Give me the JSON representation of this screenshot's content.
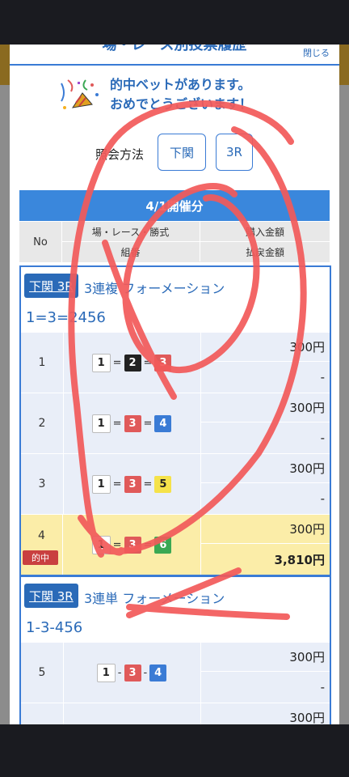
{
  "modal": {
    "title": "場・レース別投票履歴",
    "close_label": "閉じる",
    "hit_message_line1": "的中ベットがあります。",
    "hit_message_line2": "おめでとうございます！",
    "lookup_label": "照会方法",
    "lookup_buttons": [
      "下関",
      "3R"
    ]
  },
  "table": {
    "date_header": "4/1開催分",
    "col_no": "No",
    "col_race": "場・レース・勝式",
    "col_combo": "組番",
    "col_purchase": "購入金額",
    "col_payout": "払戻金額"
  },
  "blocks": [
    {
      "venue": "下関 3R",
      "bet_type": "3連複 フォーメーション",
      "combo": "1=3=2456",
      "rows": [
        {
          "no": "1",
          "boxes": [
            "1",
            "2",
            "3"
          ],
          "sep": "=",
          "purchase": "300円",
          "payout": "-"
        },
        {
          "no": "2",
          "boxes": [
            "1",
            "3",
            "4"
          ],
          "sep": "=",
          "purchase": "300円",
          "payout": "-"
        },
        {
          "no": "3",
          "boxes": [
            "1",
            "3",
            "5"
          ],
          "sep": "=",
          "purchase": "300円",
          "payout": "-"
        },
        {
          "no": "4",
          "boxes": [
            "1",
            "3",
            "6"
          ],
          "sep": "=",
          "purchase": "300円",
          "payout": "3,810円",
          "hit": true
        }
      ]
    },
    {
      "venue": "下関 3R",
      "bet_type": "3連単 フォーメーション",
      "combo": "1-3-456",
      "rows": [
        {
          "no": "5",
          "boxes": [
            "1",
            "3",
            "4"
          ],
          "sep": "-",
          "purchase": "300円",
          "payout": "-"
        },
        {
          "no": "",
          "boxes": [],
          "sep": "-",
          "purchase": "300円",
          "payout": ""
        }
      ]
    }
  ],
  "hit_badge_label": "的中",
  "colors": {
    "accent": "#3a7bd5",
    "header_blue": "#3a87dc",
    "hit_row": "#fbeda8",
    "scribble": "#f25a5a"
  }
}
